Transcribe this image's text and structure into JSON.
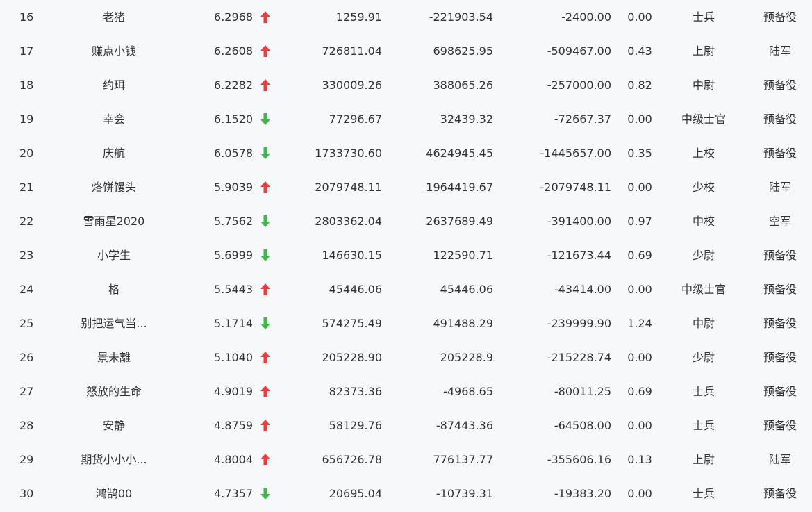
{
  "colors": {
    "background": "#f7f8fa",
    "text": "#333333",
    "up": "#ee3b3b",
    "down": "#3cb94a"
  },
  "rows": [
    {
      "rank": "16",
      "name": "老猪",
      "score": "6.2968",
      "trend": "up",
      "v1": "1259.91",
      "v2": "-221903.54",
      "v3": "-2400.00",
      "ratio": "0.00",
      "level": "士兵",
      "type": "预备役"
    },
    {
      "rank": "17",
      "name": "赚点小钱",
      "score": "6.2608",
      "trend": "up",
      "v1": "726811.04",
      "v2": "698625.95",
      "v3": "-509467.00",
      "ratio": "0.43",
      "level": "上尉",
      "type": "陆军"
    },
    {
      "rank": "18",
      "name": "约珥",
      "score": "6.2282",
      "trend": "up",
      "v1": "330009.26",
      "v2": "388065.26",
      "v3": "-257000.00",
      "ratio": "0.82",
      "level": "中尉",
      "type": "预备役"
    },
    {
      "rank": "19",
      "name": "幸会",
      "score": "6.1520",
      "trend": "down",
      "v1": "77296.67",
      "v2": "32439.32",
      "v3": "-72667.37",
      "ratio": "0.00",
      "level": "中级士官",
      "type": "预备役"
    },
    {
      "rank": "20",
      "name": "庆航",
      "score": "6.0578",
      "trend": "down",
      "v1": "1733730.60",
      "v2": "4624945.45",
      "v3": "-1445657.00",
      "ratio": "0.35",
      "level": "上校",
      "type": "预备役"
    },
    {
      "rank": "21",
      "name": "烙饼馒头",
      "score": "5.9039",
      "trend": "up",
      "v1": "2079748.11",
      "v2": "1964419.67",
      "v3": "-2079748.11",
      "ratio": "0.00",
      "level": "少校",
      "type": "陆军"
    },
    {
      "rank": "22",
      "name": "雪雨星2020",
      "score": "5.7562",
      "trend": "down",
      "v1": "2803362.04",
      "v2": "2637689.49",
      "v3": "-391400.00",
      "ratio": "0.97",
      "level": "中校",
      "type": "空军"
    },
    {
      "rank": "23",
      "name": "小学生",
      "score": "5.6999",
      "trend": "down",
      "v1": "146630.15",
      "v2": "122590.71",
      "v3": "-121673.44",
      "ratio": "0.69",
      "level": "少尉",
      "type": "预备役"
    },
    {
      "rank": "24",
      "name": "格",
      "score": "5.5443",
      "trend": "up",
      "v1": "45446.06",
      "v2": "45446.06",
      "v3": "-43414.00",
      "ratio": "0.00",
      "level": "中级士官",
      "type": "预备役"
    },
    {
      "rank": "25",
      "name": "别把运气当...",
      "score": "5.1714",
      "trend": "down",
      "v1": "574275.49",
      "v2": "491488.29",
      "v3": "-239999.90",
      "ratio": "1.24",
      "level": "中尉",
      "type": "预备役"
    },
    {
      "rank": "26",
      "name": "景未離",
      "score": "5.1040",
      "trend": "up",
      "v1": "205228.90",
      "v2": "205228.9",
      "v3": "-215228.74",
      "ratio": "0.00",
      "level": "少尉",
      "type": "预备役"
    },
    {
      "rank": "27",
      "name": "怒放的生命",
      "score": "4.9019",
      "trend": "up",
      "v1": "82373.36",
      "v2": "-4968.65",
      "v3": "-80011.25",
      "ratio": "0.69",
      "level": "士兵",
      "type": "预备役"
    },
    {
      "rank": "28",
      "name": "安静",
      "score": "4.8759",
      "trend": "up",
      "v1": "58129.76",
      "v2": "-87443.36",
      "v3": "-64508.00",
      "ratio": "0.00",
      "level": "士兵",
      "type": "预备役"
    },
    {
      "rank": "29",
      "name": "期货小小小...",
      "score": "4.8004",
      "trend": "up",
      "v1": "656726.78",
      "v2": "776137.77",
      "v3": "-355606.16",
      "ratio": "0.13",
      "level": "上尉",
      "type": "陆军"
    },
    {
      "rank": "30",
      "name": "鸿鹄00",
      "score": "4.7357",
      "trend": "down",
      "v1": "20695.04",
      "v2": "-10739.31",
      "v3": "-19383.20",
      "ratio": "0.00",
      "level": "士兵",
      "type": "预备役"
    }
  ]
}
